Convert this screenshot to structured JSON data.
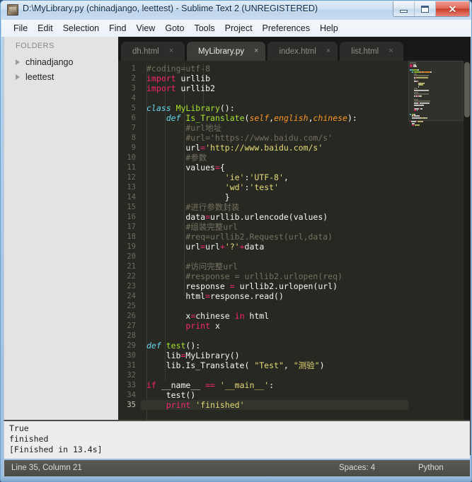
{
  "window": {
    "title": "D:\\MyLibrary.py (chinadjango, leettest) - Sublime Text 2 (UNREGISTERED)",
    "icon": "sublime-text-icon",
    "controls": {
      "minimize": "—",
      "maximize": "❐",
      "close": "✕"
    }
  },
  "menu": {
    "items": [
      {
        "label": "File"
      },
      {
        "label": "Edit"
      },
      {
        "label": "Selection"
      },
      {
        "label": "Find"
      },
      {
        "label": "View"
      },
      {
        "label": "Goto"
      },
      {
        "label": "Tools"
      },
      {
        "label": "Project"
      },
      {
        "label": "Preferences"
      },
      {
        "label": "Help"
      }
    ]
  },
  "sidebar": {
    "header": "FOLDERS",
    "folders": [
      {
        "label": "chinadjango",
        "expanded": false
      },
      {
        "label": "leettest",
        "expanded": false
      }
    ]
  },
  "tabs": [
    {
      "label": "dh.html",
      "active": false,
      "close": "×"
    },
    {
      "label": "MyLibrary.py",
      "active": true,
      "close": "×"
    },
    {
      "label": "index.html",
      "active": false,
      "close": "×"
    },
    {
      "label": "list.html",
      "active": false,
      "close": "×"
    }
  ],
  "editor": {
    "background": "#272822",
    "line_count": 35,
    "lines": [
      {
        "n": 1,
        "tokens": [
          {
            "t": "#coding=utf-8",
            "c": "c-comment"
          }
        ]
      },
      {
        "n": 2,
        "tokens": [
          {
            "t": "import",
            "c": "c-kw"
          },
          {
            "t": " urllib",
            "c": "c-plain"
          }
        ]
      },
      {
        "n": 3,
        "tokens": [
          {
            "t": "import",
            "c": "c-kw"
          },
          {
            "t": " urllib2",
            "c": "c-plain"
          }
        ]
      },
      {
        "n": 4,
        "tokens": []
      },
      {
        "n": 5,
        "tokens": [
          {
            "t": "class",
            "c": "c-kw2"
          },
          {
            "t": " ",
            "c": "c-plain"
          },
          {
            "t": "MyLibrary",
            "c": "c-fn"
          },
          {
            "t": "():",
            "c": "c-plain"
          }
        ]
      },
      {
        "n": 6,
        "tokens": [
          {
            "t": "    ",
            "c": "c-plain"
          },
          {
            "t": "def",
            "c": "c-kw2"
          },
          {
            "t": " ",
            "c": "c-plain"
          },
          {
            "t": "Is_Translate",
            "c": "c-fn"
          },
          {
            "t": "(",
            "c": "c-plain"
          },
          {
            "t": "self",
            "c": "c-param"
          },
          {
            "t": ",",
            "c": "c-plain"
          },
          {
            "t": "english",
            "c": "c-param"
          },
          {
            "t": ",",
            "c": "c-plain"
          },
          {
            "t": "chinese",
            "c": "c-param"
          },
          {
            "t": "):",
            "c": "c-plain"
          }
        ]
      },
      {
        "n": 7,
        "tokens": [
          {
            "t": "        #url地址",
            "c": "c-comment"
          }
        ]
      },
      {
        "n": 8,
        "tokens": [
          {
            "t": "        #url='https://www.baidu.com/s'",
            "c": "c-comment"
          }
        ]
      },
      {
        "n": 9,
        "tokens": [
          {
            "t": "        url",
            "c": "c-plain"
          },
          {
            "t": "=",
            "c": "c-op"
          },
          {
            "t": "'http://www.baidu.com/s'",
            "c": "c-str"
          }
        ]
      },
      {
        "n": 10,
        "tokens": [
          {
            "t": "        #参数",
            "c": "c-comment"
          }
        ]
      },
      {
        "n": 11,
        "tokens": [
          {
            "t": "        values",
            "c": "c-plain"
          },
          {
            "t": "=",
            "c": "c-op"
          },
          {
            "t": "{",
            "c": "c-plain"
          }
        ]
      },
      {
        "n": 12,
        "tokens": [
          {
            "t": "                ",
            "c": "c-plain"
          },
          {
            "t": "'ie'",
            "c": "c-str"
          },
          {
            "t": ":",
            "c": "c-plain"
          },
          {
            "t": "'UTF-8'",
            "c": "c-str"
          },
          {
            "t": ",",
            "c": "c-plain"
          }
        ]
      },
      {
        "n": 13,
        "tokens": [
          {
            "t": "                ",
            "c": "c-plain"
          },
          {
            "t": "'wd'",
            "c": "c-str"
          },
          {
            "t": ":",
            "c": "c-plain"
          },
          {
            "t": "'test'",
            "c": "c-str"
          }
        ]
      },
      {
        "n": 14,
        "tokens": [
          {
            "t": "                }",
            "c": "c-plain"
          }
        ]
      },
      {
        "n": 15,
        "tokens": [
          {
            "t": "        #进行参数封装",
            "c": "c-comment"
          }
        ]
      },
      {
        "n": 16,
        "tokens": [
          {
            "t": "        data",
            "c": "c-plain"
          },
          {
            "t": "=",
            "c": "c-op"
          },
          {
            "t": "urllib.urlencode(values)",
            "c": "c-plain"
          }
        ]
      },
      {
        "n": 17,
        "tokens": [
          {
            "t": "        #组装完整url",
            "c": "c-comment"
          }
        ]
      },
      {
        "n": 18,
        "tokens": [
          {
            "t": "        #req=urllib2.Request(url,data)",
            "c": "c-comment"
          }
        ]
      },
      {
        "n": 19,
        "tokens": [
          {
            "t": "        url",
            "c": "c-plain"
          },
          {
            "t": "=",
            "c": "c-op"
          },
          {
            "t": "url",
            "c": "c-plain"
          },
          {
            "t": "+",
            "c": "c-op"
          },
          {
            "t": "'?'",
            "c": "c-str"
          },
          {
            "t": "+",
            "c": "c-op"
          },
          {
            "t": "data",
            "c": "c-plain"
          }
        ]
      },
      {
        "n": 20,
        "tokens": []
      },
      {
        "n": 21,
        "tokens": [
          {
            "t": "        #访问完整url",
            "c": "c-comment"
          }
        ]
      },
      {
        "n": 22,
        "tokens": [
          {
            "t": "        #response = urllib2.urlopen(req)",
            "c": "c-comment"
          }
        ]
      },
      {
        "n": 23,
        "tokens": [
          {
            "t": "        response ",
            "c": "c-plain"
          },
          {
            "t": "=",
            "c": "c-op"
          },
          {
            "t": " urllib2.urlopen(url)",
            "c": "c-plain"
          }
        ]
      },
      {
        "n": 24,
        "tokens": [
          {
            "t": "        html",
            "c": "c-plain"
          },
          {
            "t": "=",
            "c": "c-op"
          },
          {
            "t": "response.read()",
            "c": "c-plain"
          }
        ]
      },
      {
        "n": 25,
        "tokens": []
      },
      {
        "n": 26,
        "tokens": [
          {
            "t": "        x",
            "c": "c-plain"
          },
          {
            "t": "=",
            "c": "c-op"
          },
          {
            "t": "chinese ",
            "c": "c-plain"
          },
          {
            "t": "in",
            "c": "c-kw"
          },
          {
            "t": " html",
            "c": "c-plain"
          }
        ]
      },
      {
        "n": 27,
        "tokens": [
          {
            "t": "        ",
            "c": "c-plain"
          },
          {
            "t": "print",
            "c": "c-kw"
          },
          {
            "t": " x",
            "c": "c-plain"
          }
        ]
      },
      {
        "n": 28,
        "tokens": []
      },
      {
        "n": 29,
        "tokens": [
          {
            "t": "def",
            "c": "c-kw2"
          },
          {
            "t": " ",
            "c": "c-plain"
          },
          {
            "t": "test",
            "c": "c-fn"
          },
          {
            "t": "():",
            "c": "c-plain"
          }
        ]
      },
      {
        "n": 30,
        "tokens": [
          {
            "t": "    lib",
            "c": "c-plain"
          },
          {
            "t": "=",
            "c": "c-op"
          },
          {
            "t": "MyLibrary()",
            "c": "c-plain"
          }
        ]
      },
      {
        "n": 31,
        "tokens": [
          {
            "t": "    lib.Is_Translate( ",
            "c": "c-plain"
          },
          {
            "t": "\"Test\"",
            "c": "c-str"
          },
          {
            "t": ", ",
            "c": "c-plain"
          },
          {
            "t": "\"测验\"",
            "c": "c-str"
          },
          {
            "t": ")",
            "c": "c-plain"
          }
        ]
      },
      {
        "n": 32,
        "tokens": []
      },
      {
        "n": 33,
        "tokens": [
          {
            "t": "if",
            "c": "c-kw"
          },
          {
            "t": " __name__ ",
            "c": "c-plain"
          },
          {
            "t": "==",
            "c": "c-op"
          },
          {
            "t": " ",
            "c": "c-plain"
          },
          {
            "t": "'__main__'",
            "c": "c-str"
          },
          {
            "t": ":",
            "c": "c-plain"
          }
        ]
      },
      {
        "n": 34,
        "tokens": [
          {
            "t": "    test()",
            "c": "c-plain"
          }
        ]
      },
      {
        "n": 35,
        "tokens": [
          {
            "t": "    ",
            "c": "c-plain"
          },
          {
            "t": "print",
            "c": "c-kw"
          },
          {
            "t": " ",
            "c": "c-plain"
          },
          {
            "t": "'finished'",
            "c": "c-str"
          }
        ],
        "current": true
      }
    ],
    "current_line": 35
  },
  "console": {
    "lines": [
      "True",
      "finished",
      "[Finished in 13.4s]"
    ]
  },
  "statusbar": {
    "position": "Line 35, Column 21",
    "indent": "Spaces: 4",
    "language": "Python"
  },
  "colors": {
    "editor_bg": "#272822",
    "comment": "#75715e",
    "keyword": "#f92672",
    "storage": "#66d9ef",
    "function": "#a6e22e",
    "parameter": "#fd971f",
    "string": "#e6db74",
    "plain": "#f8f8f2",
    "tabbar_bg": "#181818",
    "sidebar_bg": "#e3e3e3",
    "statusbar_bg": "#4f4f4a",
    "titlebar_accent": "#c63f2b"
  }
}
